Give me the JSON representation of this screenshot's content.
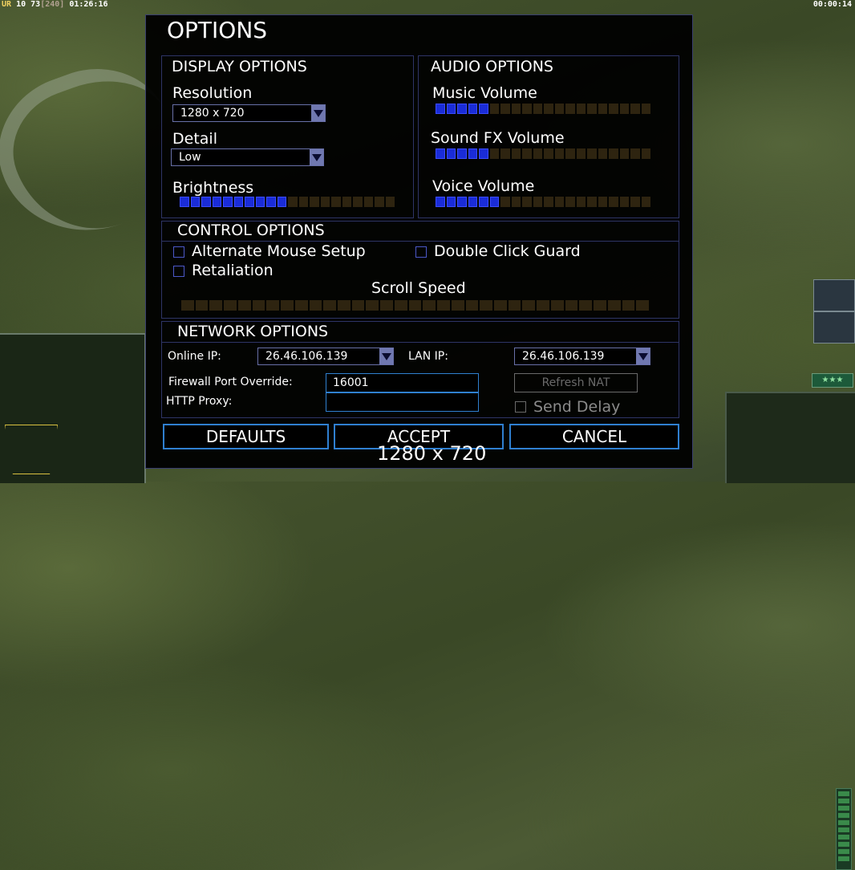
{
  "hud": {
    "left_prefix": "UR",
    "left_count": "10 73",
    "left_bracket": "[240]",
    "left_time": "01:26:16",
    "right_time": "00:00:14"
  },
  "dialog": {
    "title": "OPTIONS",
    "display": {
      "title": "DISPLAY OPTIONS",
      "resolution_label": "Resolution",
      "resolution_value": "1280 x 720",
      "detail_label": "Detail",
      "detail_value": "Low",
      "brightness_label": "Brightness",
      "brightness_level": 0.5
    },
    "audio": {
      "title": "AUDIO OPTIONS",
      "music_label": "Music Volume",
      "music_level": 0.25,
      "sfx_label": "Sound FX Volume",
      "sfx_level": 0.25,
      "voice_label": "Voice Volume",
      "voice_level": 0.3
    },
    "control": {
      "title": "CONTROL OPTIONS",
      "alt_mouse": "Alternate Mouse Setup",
      "double_click": "Double Click Guard",
      "retaliation": "Retaliation",
      "scroll_label": "Scroll Speed",
      "scroll_level": 0
    },
    "network": {
      "title": "NETWORK OPTIONS",
      "online_ip_label": "Online IP:",
      "online_ip_value": "26.46.106.139",
      "lan_ip_label": "LAN IP:",
      "lan_ip_value": "26.46.106.139",
      "firewall_label": "Firewall Port Override:",
      "firewall_value": "16001",
      "proxy_label": "HTTP Proxy:",
      "proxy_value": "",
      "refresh_nat": "Refresh NAT",
      "send_delay": "Send Delay"
    },
    "buttons": {
      "defaults": "DEFAULTS",
      "accept": "ACCEPT",
      "cancel": "CANCEL"
    }
  },
  "resolution_overlay": "1280 x 720",
  "rank_stars": "★★★",
  "colors": {
    "slider_on": "#1a2cd8",
    "slider_off": "#2e2410",
    "frame": "#2f7fd0"
  }
}
